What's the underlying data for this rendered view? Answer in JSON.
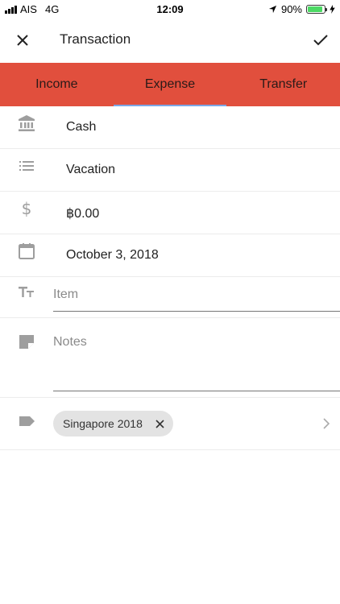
{
  "status_bar": {
    "carrier": "AIS",
    "network": "4G",
    "time": "12:09",
    "battery_percent": "90%",
    "battery_level": 0.9
  },
  "appbar": {
    "title": "Transaction",
    "close_icon": "close-icon",
    "confirm_icon": "check-icon"
  },
  "tabs": [
    {
      "label": "Income",
      "active": false
    },
    {
      "label": "Expense",
      "active": true
    },
    {
      "label": "Transfer",
      "active": false
    }
  ],
  "form": {
    "account": "Cash",
    "category": "Vacation",
    "amount": "฿0.00",
    "date": "October 3, 2018",
    "item_placeholder": "Item",
    "notes_placeholder": "Notes",
    "tag": "Singapore 2018"
  },
  "colors": {
    "tab_bar": "#e14f3d",
    "active_tab_indicator": "#7ba7e6",
    "icon": "#9e9e9e",
    "chip": "#e3e3e3"
  }
}
